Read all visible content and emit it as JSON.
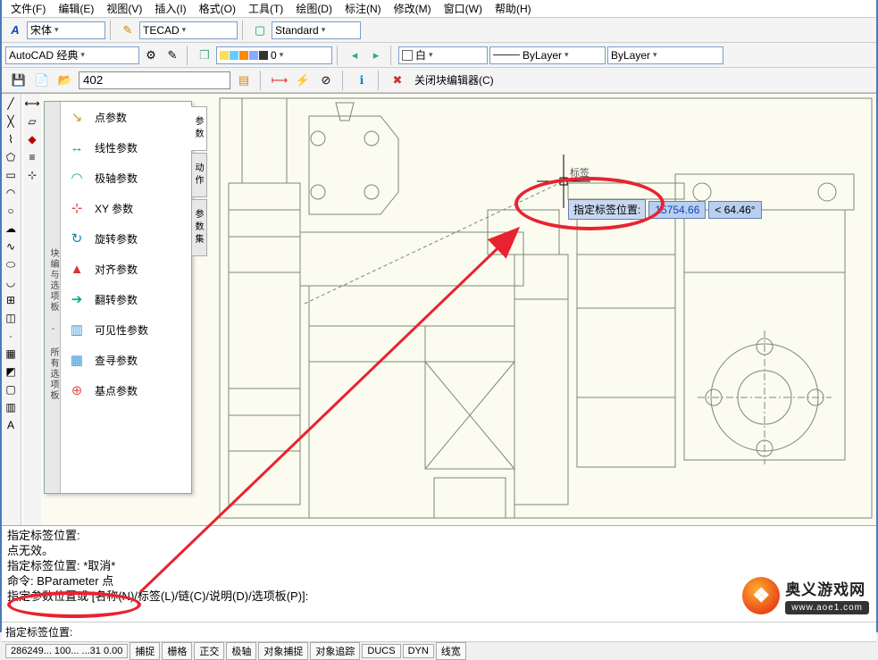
{
  "menus": {
    "file": "文件(F)",
    "edit": "编辑(E)",
    "view": "视图(V)",
    "insert": "插入(I)",
    "format": "格式(O)",
    "tools": "工具(T)",
    "draw": "绘图(D)",
    "dimension": "标注(N)",
    "modify": "修改(M)",
    "window": "窗口(W)",
    "help": "帮助(H)"
  },
  "row1": {
    "font_icon": "A",
    "font": "宋体",
    "style_icon": "✎",
    "style": "TECAD",
    "dim_icon": "▢",
    "dim": "Standard"
  },
  "row2": {
    "workspace": "AutoCAD 经典",
    "layer_current": "0",
    "colorsel": "白",
    "line1": "ByLayer",
    "line2": "———",
    "line3": "ByLayer"
  },
  "row3": {
    "search": "402",
    "close_editor": "关闭块编辑器(C)"
  },
  "palette": {
    "title": "块编与选项板 - 所有选项板",
    "tabs": {
      "params": "参数",
      "actions": "动作",
      "paramsets": "参数集"
    },
    "items": [
      {
        "icon": "↘",
        "color": "#c93",
        "label": "点参数"
      },
      {
        "icon": "↔",
        "color": "#1a8",
        "label": "线性参数"
      },
      {
        "icon": "◠",
        "color": "#1a8",
        "label": "极轴参数"
      },
      {
        "icon": "⊹",
        "color": "#d33",
        "label": "XY 参数"
      },
      {
        "icon": "↻",
        "color": "#18a",
        "label": "旋转参数"
      },
      {
        "icon": "▲",
        "color": "#d33",
        "label": "对齐参数"
      },
      {
        "icon": "➔",
        "color": "#0a8",
        "label": "翻转参数"
      },
      {
        "icon": "▥",
        "color": "#39d",
        "label": "可见性参数"
      },
      {
        "icon": "▦",
        "color": "#39d",
        "label": "查寻参数"
      },
      {
        "icon": "⊕",
        "color": "#d55",
        "label": "基点参数"
      }
    ]
  },
  "dyn": {
    "label": "指定标签位置:",
    "distance": "15754.66",
    "angle": "< 64.46°",
    "cursor_text": "标签"
  },
  "cmdlog": [
    "指定标签位置:",
    "点无效。",
    "指定标签位置:  *取消*",
    "命令:  BParameter 点",
    "指定参数位置或 [名称(N)/标签(L)/链(C)/说明(D)/选项板(P)]:"
  ],
  "cmd_prompt": "指定标签位置:",
  "status": {
    "coords": "286249...  100...  ...31  0.00",
    "snap": "捕捉",
    "grid": "栅格",
    "ortho": "正交",
    "polar": "极轴",
    "osnap": "对象捕捉",
    "otrack": "对象追踪",
    "ducs": "DUCS",
    "dyn": "DYN",
    "lwt": "线宽"
  },
  "watermark": {
    "name": "奥义游戏网",
    "url": "www.aoe1.com"
  }
}
